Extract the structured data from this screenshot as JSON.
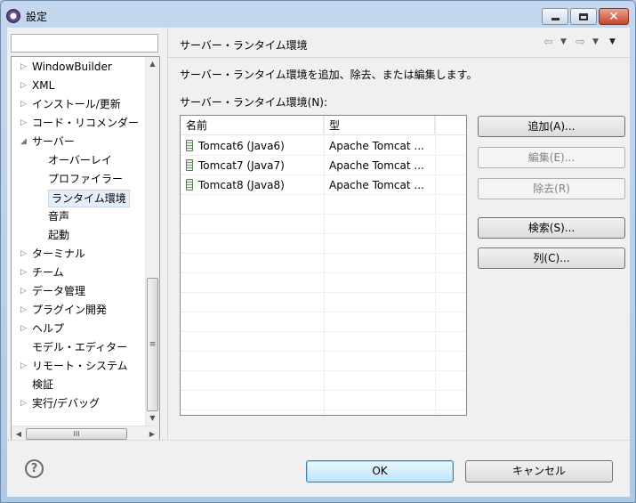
{
  "window": {
    "title": "設定"
  },
  "sidebar": {
    "filter_value": "",
    "tree": [
      {
        "label": "WindowBuilder",
        "level": 0,
        "arrow": "▷"
      },
      {
        "label": "XML",
        "level": 0,
        "arrow": "▷"
      },
      {
        "label": "インストール/更新",
        "level": 0,
        "arrow": "▷"
      },
      {
        "label": "コード・リコメンダー",
        "level": 0,
        "arrow": "▷"
      },
      {
        "label": "サーバー",
        "level": 0,
        "arrow": "◢"
      },
      {
        "label": "オーバーレイ",
        "level": 1,
        "arrow": ""
      },
      {
        "label": "プロファイラー",
        "level": 1,
        "arrow": ""
      },
      {
        "label": "ランタイム環境",
        "level": 1,
        "arrow": "",
        "selected": true
      },
      {
        "label": "音声",
        "level": 1,
        "arrow": ""
      },
      {
        "label": "起動",
        "level": 1,
        "arrow": ""
      },
      {
        "label": "ターミナル",
        "level": 0,
        "arrow": "▷"
      },
      {
        "label": "チーム",
        "level": 0,
        "arrow": "▷"
      },
      {
        "label": "データ管理",
        "level": 0,
        "arrow": "▷"
      },
      {
        "label": "プラグイン開発",
        "level": 0,
        "arrow": "▷"
      },
      {
        "label": "ヘルプ",
        "level": 0,
        "arrow": "▷"
      },
      {
        "label": "モデル・エディター",
        "level": 0,
        "arrow": ""
      },
      {
        "label": "リモート・システム",
        "level": 0,
        "arrow": "▷"
      },
      {
        "label": "検証",
        "level": 0,
        "arrow": ""
      },
      {
        "label": "実行/デバッグ",
        "level": 0,
        "arrow": "▷"
      }
    ]
  },
  "page": {
    "title": "サーバー・ランタイム環境",
    "description": "サーバー・ランタイム環境を追加、除去、または編集します。",
    "list_label": "サーバー・ランタイム環境(N):",
    "columns": [
      "名前",
      "型"
    ],
    "rows": [
      {
        "name": "Tomcat6 (Java6)",
        "type": "Apache Tomcat ..."
      },
      {
        "name": "Tomcat7 (Java7)",
        "type": "Apache Tomcat ..."
      },
      {
        "name": "Tomcat8 (Java8)",
        "type": "Apache Tomcat ..."
      }
    ],
    "buttons": {
      "add": "追加(A)...",
      "edit": "編集(E)...",
      "remove": "除去(R)",
      "search": "検索(S)...",
      "columns": "列(C)..."
    }
  },
  "footer": {
    "ok": "OK",
    "cancel": "キャンセル"
  }
}
